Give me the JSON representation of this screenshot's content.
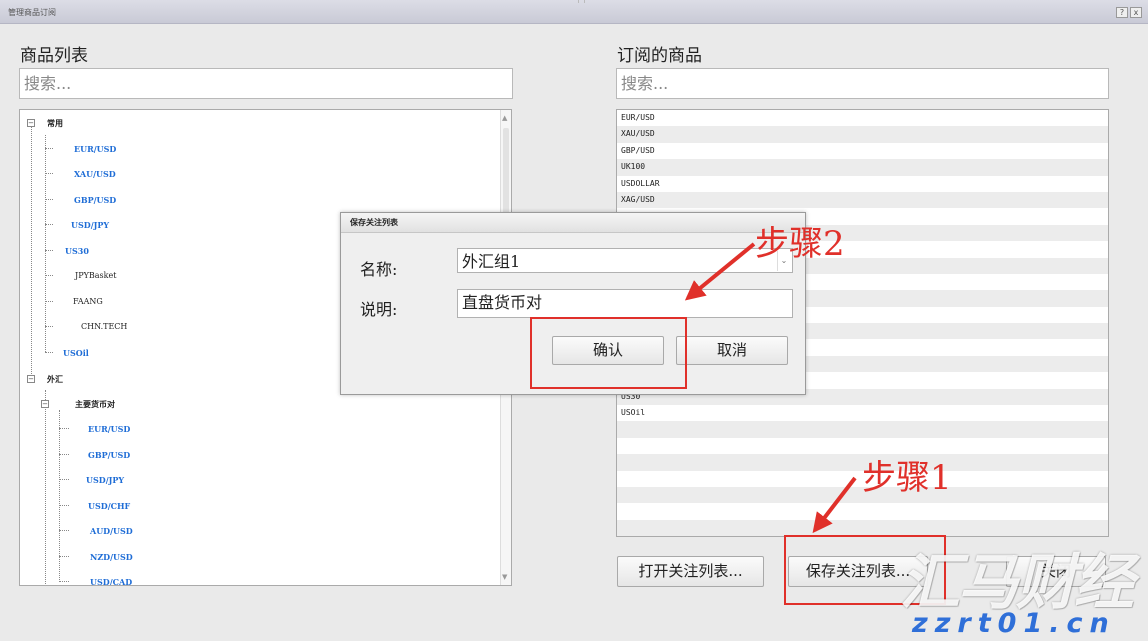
{
  "window": {
    "title": "管理商品订阅",
    "help_label": "?",
    "close_label": "x"
  },
  "left_panel": {
    "title": "商品列表",
    "search_placeholder": "搜索..."
  },
  "tree": {
    "common_group": "常用",
    "common_items": [
      "EUR/USD",
      "XAU/USD",
      "GBP/USD",
      "USD/JPY",
      "US30",
      "JPYBasket",
      "FAANG",
      "CHN.TECH",
      "USOil"
    ],
    "forex_group": "外汇",
    "major_group": "主要货币对",
    "major_items": [
      "EUR/USD",
      "GBP/USD",
      "USD/JPY",
      "USD/CHF",
      "AUD/USD",
      "NZD/USD",
      "USD/CAD"
    ],
    "collapse_glyph": "−",
    "scroll_up_glyph": "▲",
    "scroll_down_glyph": "▼"
  },
  "right_panel": {
    "title": "订阅的商品",
    "search_placeholder": "搜索...",
    "items": [
      "EUR/USD",
      "XAU/USD",
      "GBP/USD",
      "UK100",
      "USDOLLAR",
      "XAG/USD",
      "",
      "",
      "",
      "",
      "",
      "",
      "",
      "",
      "",
      "",
      "",
      "US30",
      "USOil",
      "",
      "",
      "",
      "",
      "",
      "",
      ""
    ]
  },
  "buttons": {
    "open_list": "打开关注列表...",
    "save_list": "保存关注列表...",
    "close": "关闭"
  },
  "dialog": {
    "title": "保存关注列表",
    "name_label": "名称:",
    "name_value": "外汇组1",
    "name_dropdown_glyph": "⌄",
    "desc_label": "说明:",
    "desc_value": "直盘货币对",
    "confirm": "确认",
    "cancel": "取消"
  },
  "annotations": {
    "step1": "步骤1",
    "step2": "步骤2",
    "color": "#e0302a"
  },
  "watermark": {
    "brand": "汇马财经",
    "url": "zzrt01.cn"
  }
}
